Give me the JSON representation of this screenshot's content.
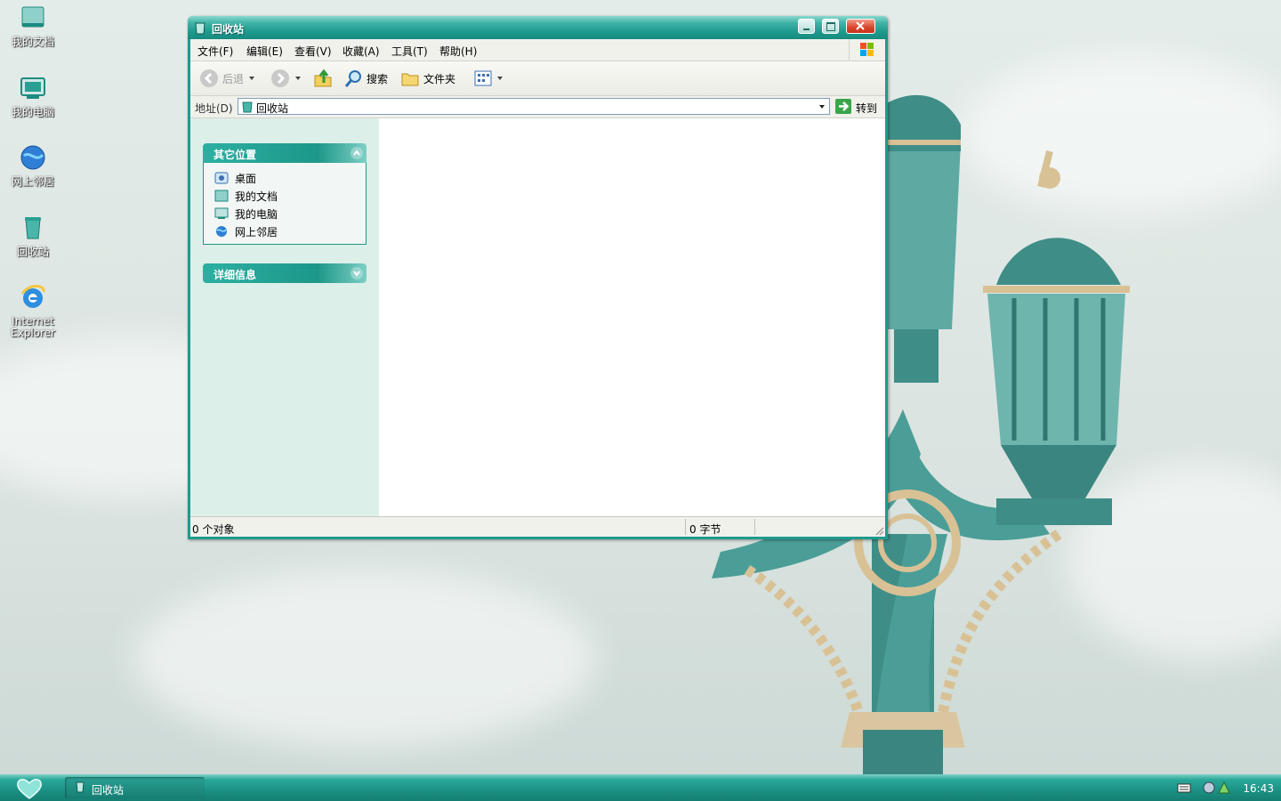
{
  "desktop": {
    "icons": [
      {
        "label": "我的文档",
        "icon": "my-documents-icon"
      },
      {
        "label": "我的电脑",
        "icon": "my-computer-icon"
      },
      {
        "label": "网上邻居",
        "icon": "network-places-icon"
      },
      {
        "label": "回收站",
        "icon": "recycle-bin-icon"
      },
      {
        "label_line1": "Internet",
        "label_line2": "Explorer",
        "icon": "internet-explorer-icon"
      }
    ]
  },
  "window": {
    "title": "回收站",
    "menu": [
      "文件(F)",
      "编辑(E)",
      "查看(V)",
      "收藏(A)",
      "工具(T)",
      "帮助(H)"
    ],
    "toolbar": {
      "back": "后退",
      "search": "搜索",
      "folders": "文件夹"
    },
    "address": {
      "label": "地址(D)",
      "value": "回收站",
      "go": "转到"
    },
    "sidebar": {
      "other_places": {
        "title": "其它位置",
        "items": [
          "桌面",
          "我的文档",
          "我的电脑",
          "网上邻居"
        ]
      },
      "details": {
        "title": "详细信息"
      }
    },
    "status": {
      "objects": "0 个对象",
      "size": "0 字节"
    }
  },
  "taskbar": {
    "item": "回收站",
    "clock": "16:43"
  },
  "colors": {
    "accent": "#1d9789",
    "taskbar": "#1c9184",
    "sidebar": "#ddefe9"
  }
}
